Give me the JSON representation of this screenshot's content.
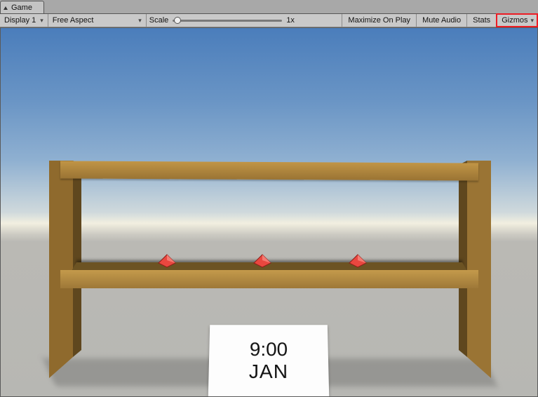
{
  "tab": {
    "title": "Game"
  },
  "toolbar": {
    "display": "Display 1",
    "aspect": "Free Aspect",
    "scale_label": "Scale",
    "scale_value": "1x",
    "maximize": "Maximize On Play",
    "mute": "Mute Audio",
    "stats": "Stats",
    "gizmos": "Gizmos"
  },
  "card": {
    "time": "9:00",
    "month": "JAN"
  },
  "gizmo_icons": [
    "audio-gizmo",
    "audio-gizmo",
    "audio-gizmo"
  ]
}
